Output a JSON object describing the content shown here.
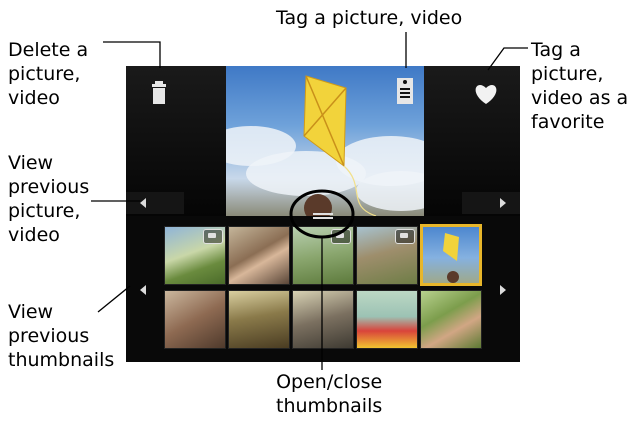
{
  "callouts": {
    "delete": "Delete a\npicture,\nvideo",
    "tag": "Tag a picture, video",
    "favorite": "Tag a\npicture,\nvideo as a\nfavorite",
    "prev_picture": "View\nprevious\npicture,\nvideo",
    "prev_thumbnails": "View\nprevious\nthumbnails",
    "open_close": "Open/close\nthumbnails"
  },
  "icons": {
    "delete": "trash-icon",
    "tag": "tag-icon",
    "favorite": "heart-icon",
    "prev_picture": "arrow-left-icon",
    "next_picture": "arrow-right-icon",
    "prev_thumbs": "arrow-left-icon",
    "next_thumbs": "arrow-right-icon",
    "handle": "thumbnail-handle-icon",
    "video_badge": "video-badge-icon"
  },
  "thumbnails": {
    "row1": [
      {
        "name": "thumb-family-field",
        "video": true
      },
      {
        "name": "thumb-couple",
        "video": false
      },
      {
        "name": "thumb-kids-grass",
        "video": true
      },
      {
        "name": "thumb-people-sitting",
        "video": true
      },
      {
        "name": "thumb-kite-selected",
        "video": false,
        "selected": true
      }
    ],
    "row2": [
      {
        "name": "thumb-father-son",
        "video": false
      },
      {
        "name": "thumb-shoulder-ride",
        "video": false
      },
      {
        "name": "thumb-couple-trees",
        "video": false
      },
      {
        "name": "thumb-child-ball",
        "video": false
      },
      {
        "name": "thumb-smiling-child",
        "video": false
      }
    ]
  },
  "colors": {
    "selection_border": "#e8b62a",
    "kite": "#f2d33b",
    "screen_bg": "#0b0b0b"
  }
}
